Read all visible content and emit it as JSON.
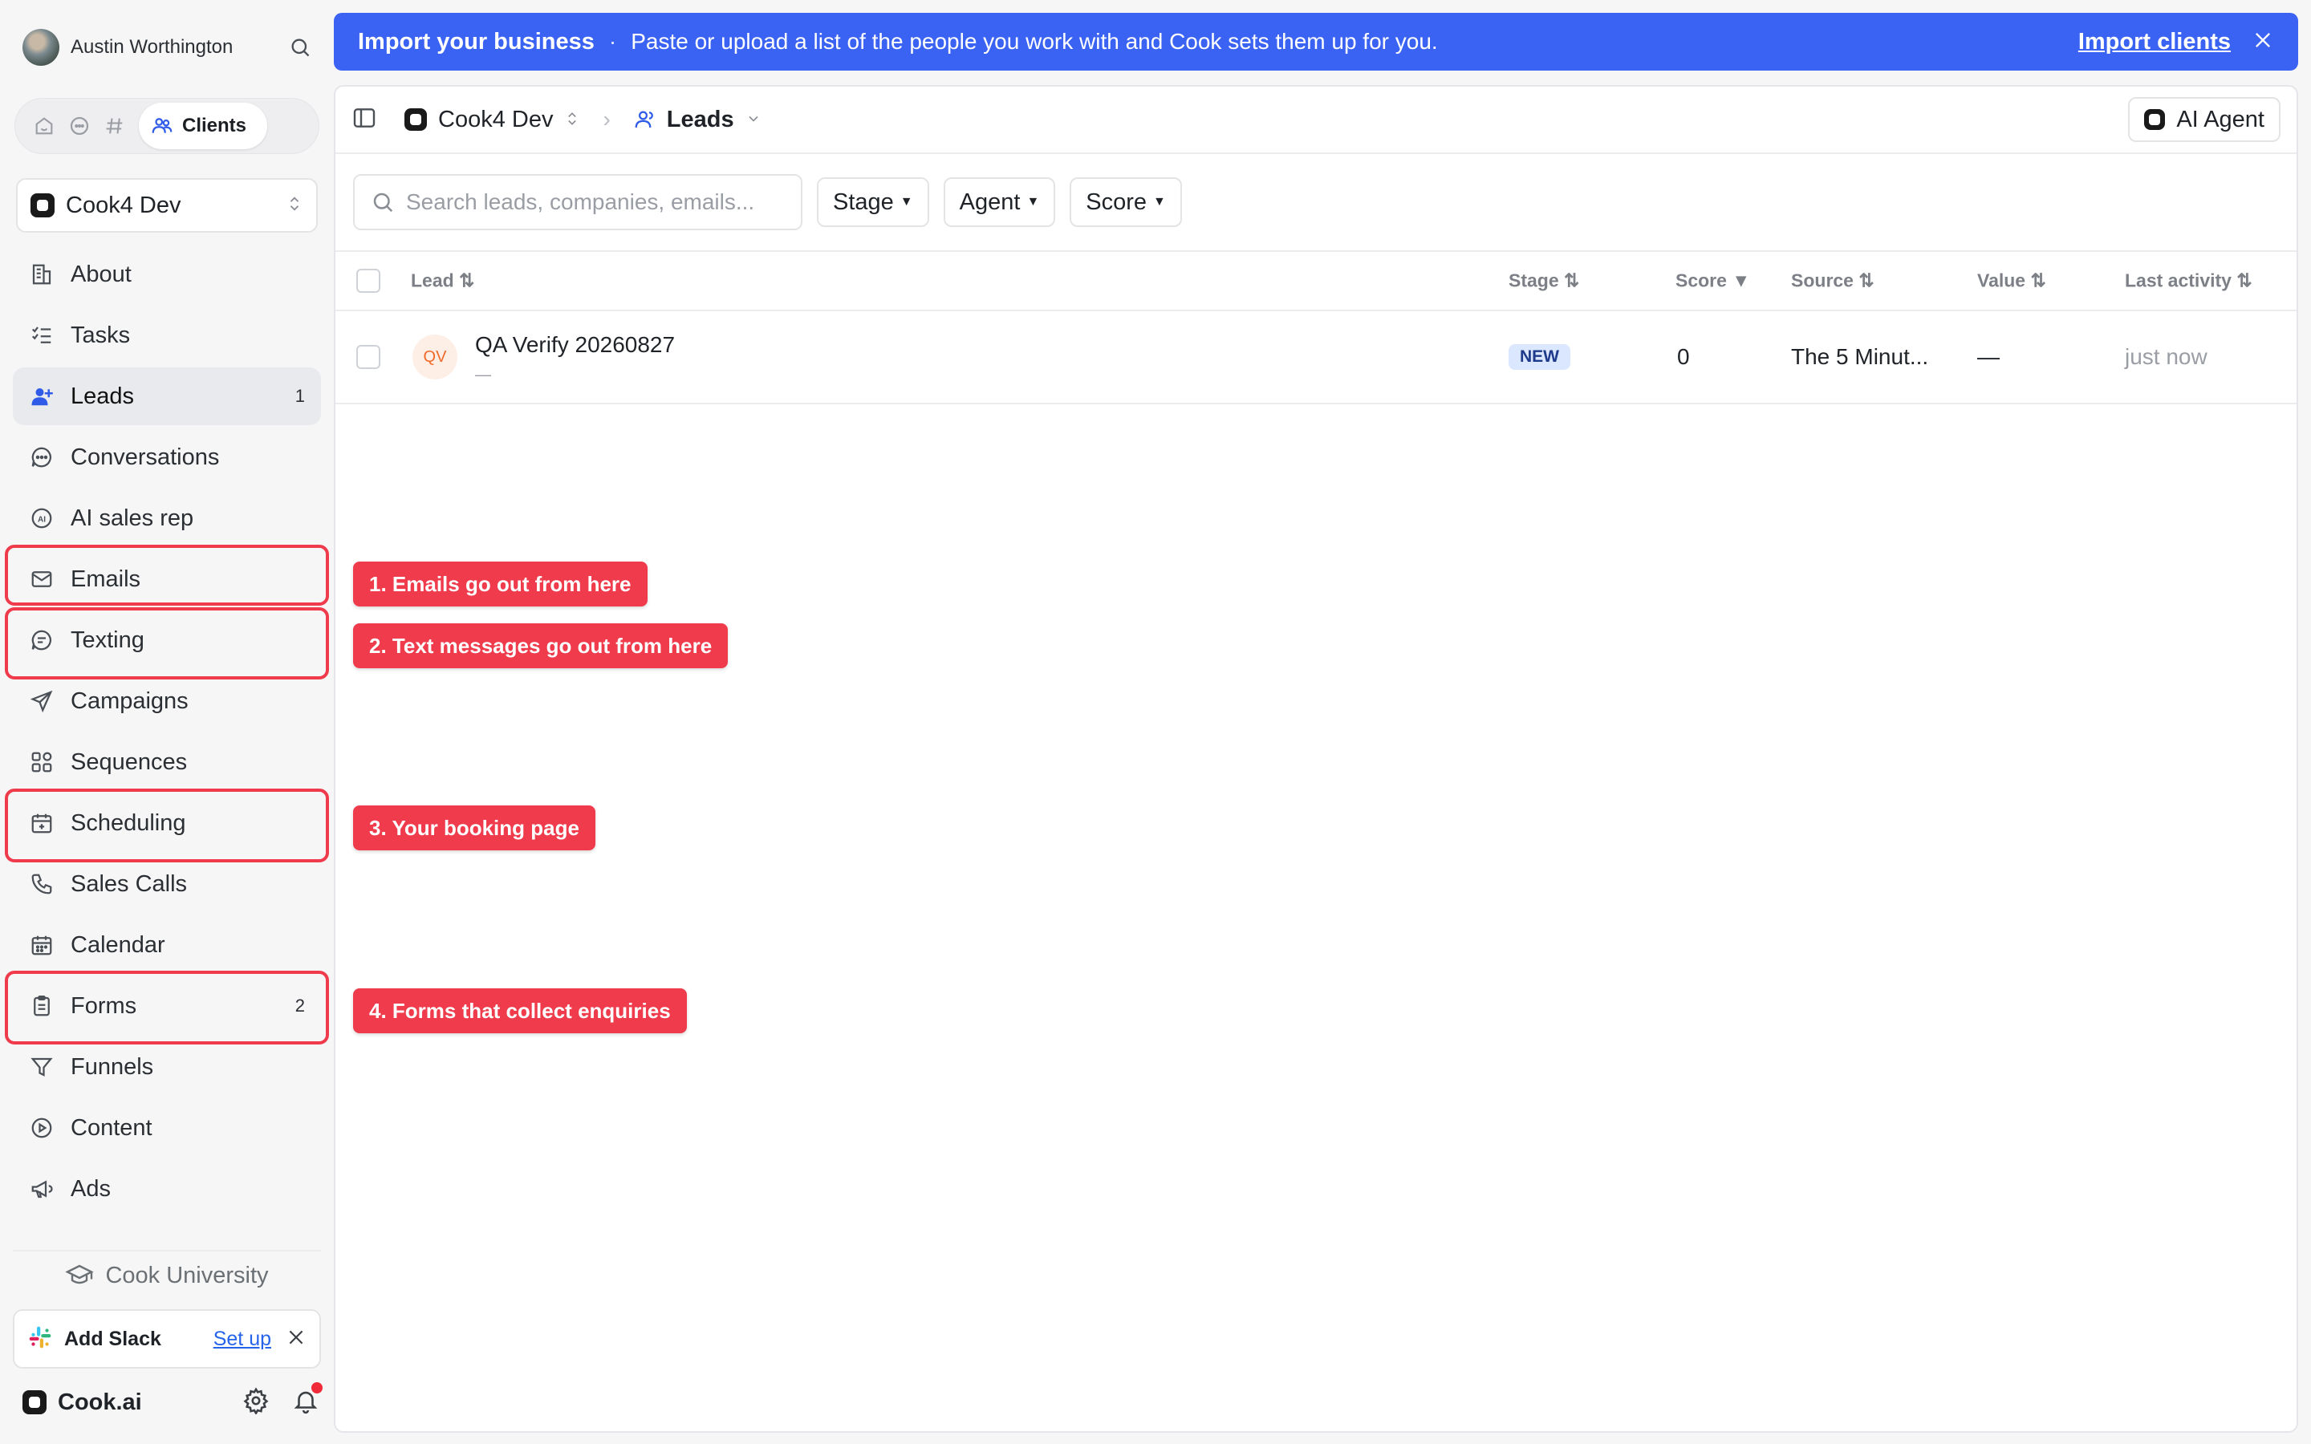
{
  "user": {
    "name": "Austin Worthington"
  },
  "switcher": {
    "active_label": "Clients"
  },
  "workspace": {
    "name": "Cook4 Dev"
  },
  "nav": [
    {
      "label": "About",
      "icon": "building-icon",
      "badge": ""
    },
    {
      "label": "Tasks",
      "icon": "checklist-icon",
      "badge": ""
    },
    {
      "label": "Leads",
      "icon": "user-plus-icon",
      "badge": "1"
    },
    {
      "label": "Conversations",
      "icon": "chat-bubble-icon",
      "badge": ""
    },
    {
      "label": "AI sales rep",
      "icon": "ai-icon",
      "badge": ""
    },
    {
      "label": "Emails",
      "icon": "mail-icon",
      "badge": ""
    },
    {
      "label": "Texting",
      "icon": "message-icon",
      "badge": ""
    },
    {
      "label": "Campaigns",
      "icon": "send-icon",
      "badge": ""
    },
    {
      "label": "Sequences",
      "icon": "grid-icon",
      "badge": ""
    },
    {
      "label": "Scheduling",
      "icon": "calendar-plus-icon",
      "badge": ""
    },
    {
      "label": "Sales Calls",
      "icon": "phone-icon",
      "badge": ""
    },
    {
      "label": "Calendar",
      "icon": "calendar-icon",
      "badge": ""
    },
    {
      "label": "Forms",
      "icon": "clipboard-icon",
      "badge": "2"
    },
    {
      "label": "Funnels",
      "icon": "funnel-icon",
      "badge": ""
    },
    {
      "label": "Content",
      "icon": "play-circle-icon",
      "badge": ""
    },
    {
      "label": "Ads",
      "icon": "megaphone-icon",
      "badge": ""
    }
  ],
  "university": {
    "label": "Cook University"
  },
  "slack": {
    "label": "Add Slack",
    "action": "Set up"
  },
  "footer": {
    "brand": "Cook.ai"
  },
  "banner": {
    "title": "Import your business",
    "separator": "·",
    "text": "Paste or upload a list of the people you work with and Cook sets them up for you.",
    "link": "Import clients"
  },
  "breadcrumb": {
    "workspace": "Cook4 Dev",
    "page": "Leads",
    "separator": "›"
  },
  "agent_button": "AI Agent",
  "search": {
    "placeholder": "Search leads, companies, emails..."
  },
  "filters": [
    "Stage",
    "Agent",
    "Score"
  ],
  "table": {
    "columns": [
      "Lead ⇅",
      "Stage ⇅",
      "Score ▼",
      "Source ⇅",
      "Value ⇅",
      "Last activity ⇅"
    ],
    "rows": [
      {
        "initials": "QV",
        "name": "QA Verify 20260827",
        "sub": "—",
        "stage": "NEW",
        "score": "0",
        "source": "The 5 Minut...",
        "value": "—",
        "last_activity": "just now"
      }
    ]
  },
  "annotations": [
    "1. Emails go out from here",
    "2. Text messages go out from here",
    "3. Your booking page",
    "4. Forms that collect enquiries"
  ],
  "colors": {
    "accent": "#3b63f3",
    "annotation": "#ef3b4c",
    "badge_bg": "#dbe6ff",
    "avatar_text": "#f06a2a",
    "notification": "#ef2b3a"
  }
}
